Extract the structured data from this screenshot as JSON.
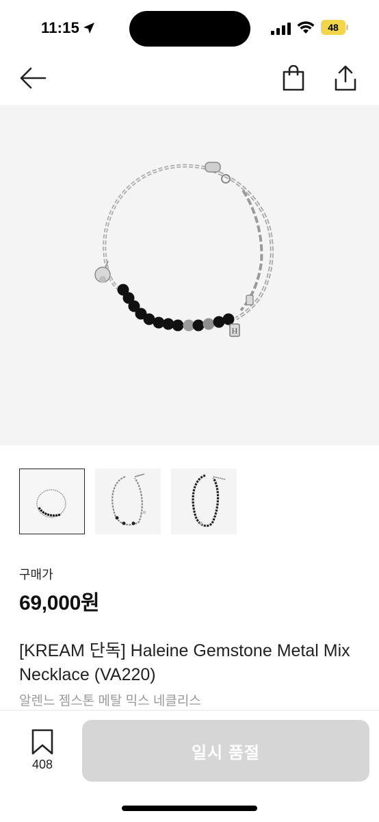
{
  "status_bar": {
    "time": "11:15",
    "battery": "48",
    "battery_color": "#f3d54b"
  },
  "nav": {
    "back_icon": "arrow-left-icon",
    "bag_icon": "shopping-bag-icon",
    "share_icon": "share-icon"
  },
  "product": {
    "price_label": "구매가",
    "price": "69,000원",
    "title": "[KREAM 단독] Haleine Gemstone Metal Mix Necklace (VA220)",
    "subtitle": "알렌느 젬스톤 메탈 믹스 네클리스",
    "thumbnails": [
      "bracelet-front",
      "necklace-silver",
      "necklace-black"
    ]
  },
  "bottom": {
    "wish_icon": "bookmark-icon",
    "wish_count": "408",
    "button_label": "일시 품절",
    "button_color": "#d6d6d6"
  }
}
